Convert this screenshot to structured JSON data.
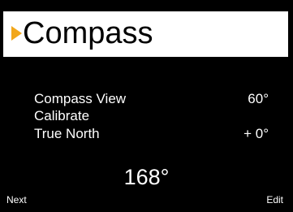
{
  "header": {
    "title": "Compass",
    "selection_indicator_icon": "right-triangle-icon",
    "accent_color": "#f2a71b"
  },
  "menu": {
    "items": [
      {
        "label": "Compass View",
        "value": "60°"
      },
      {
        "label": "Calibrate",
        "value": ""
      },
      {
        "label": "True North",
        "value": "+ 0°"
      }
    ]
  },
  "heading": {
    "value": "168°"
  },
  "softkeys": {
    "left": "Next",
    "right": "Edit"
  }
}
